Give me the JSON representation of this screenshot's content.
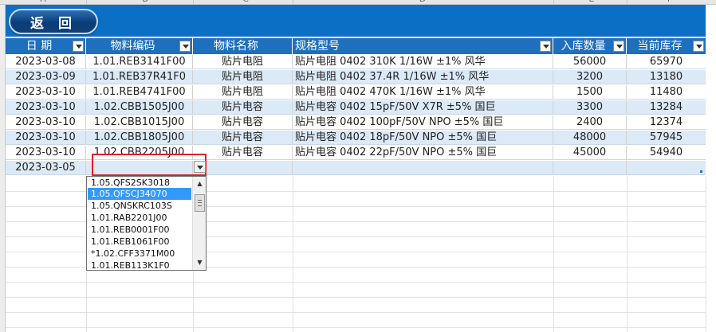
{
  "columns": [
    "A",
    "B",
    "C",
    "D",
    "E",
    "F"
  ],
  "back_button": "返 回",
  "headers": [
    "日 期",
    "物料编码",
    "物料名称",
    "规格型号",
    "入库数量",
    "当前库存"
  ],
  "rows": [
    [
      "2023-03-08",
      "1.01.REB3141F00",
      "贴片电阻",
      "贴片电阻 0402 310K 1/16W ±1% 风华",
      "56000",
      "65970"
    ],
    [
      "2023-03-09",
      "1.01.REB37R41F0",
      "贴片电阻",
      "贴片电阻 0402 37.4R 1/16W ±1%  风华",
      "3200",
      "13180"
    ],
    [
      "2023-03-10",
      "1.01.REB4741F00",
      "贴片电阻",
      "贴片电阻 0402 470K 1/16W ±1%  风华",
      "1500",
      "11480"
    ],
    [
      "2023-03-10",
      "1.02.CBB1505J00",
      "贴片电容",
      "贴片电容 0402 15pF/50V X7R ±5% 国巨",
      "3300",
      "13284"
    ],
    [
      "2023-03-10",
      "1.02.CBB1015J00",
      "贴片电容",
      "贴片电容 0402 100pF/50V NPO ±5% 国巨",
      "2400",
      "12374"
    ],
    [
      "2023-03-10",
      "1.02.CBB1805J00",
      "贴片电容",
      "贴片电容 0402 18pF/50V NPO ±5% 国巨",
      "48000",
      "57945"
    ],
    [
      "2023-03-10",
      "1.02.CBB2205J00",
      "贴片电容",
      "贴片电容 0402 22pF/50V NPO ±5% 国巨",
      "45000",
      "54940"
    ]
  ],
  "editing_row": {
    "date": "2023-03-05",
    "code": ""
  },
  "dropdown_options": [
    "1.05.QFS2SK3018",
    "1.05.QFSCJ34070",
    "1.05.QNSKRC103S",
    "1.01.RAB2201J00",
    "1.01.REB0001F00",
    "1.01.REB1061F00",
    "*1.02.CFF3371M00",
    "1.01.REB113K1F0"
  ],
  "dropdown_selected_index": 1,
  "colors": {
    "banner": "#0b70c5",
    "header": "#1f6fbf",
    "alt_row": "#dce9f7",
    "highlight": "#e02020",
    "selected_option": "#3399ff"
  },
  "icons": {
    "filter": "filter-dropdown-icon",
    "scroll_up": "scroll-up-icon",
    "scroll_down": "scroll-down-icon"
  }
}
